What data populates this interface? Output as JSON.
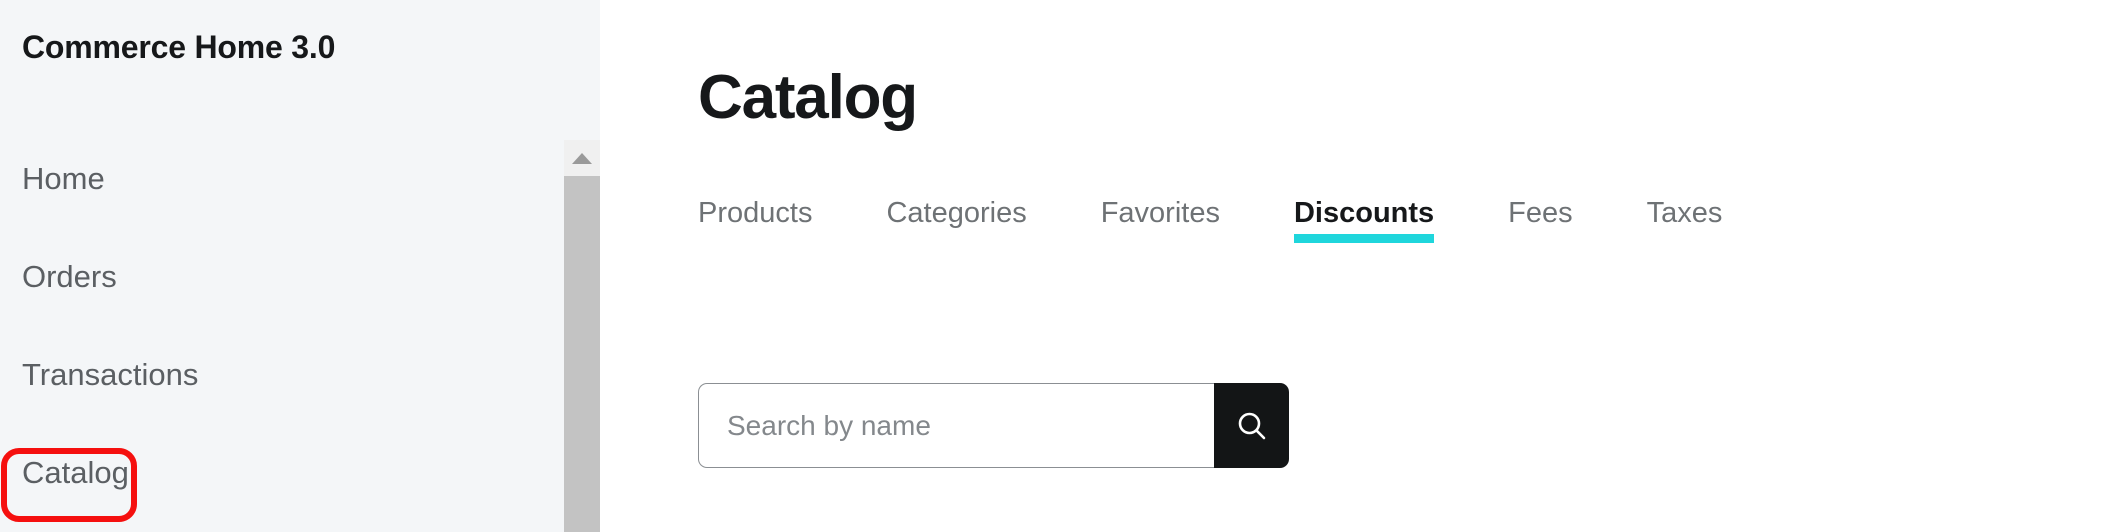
{
  "sidebar": {
    "title": "Commerce Home 3.0",
    "items": [
      {
        "label": "Home",
        "name": "sidebar-item-home"
      },
      {
        "label": "Orders",
        "name": "sidebar-item-orders"
      },
      {
        "label": "Transactions",
        "name": "sidebar-item-transactions"
      },
      {
        "label": "Catalog",
        "name": "sidebar-item-catalog"
      }
    ],
    "scrollbar": {
      "up_arrow_icon": "triangle-up-icon",
      "thumb_color": "#c3c3c3",
      "track_color": "#f0f0f0"
    },
    "annotation": {
      "target_label": "Catalog",
      "color": "#f5100f"
    },
    "background_color": "#f4f6f8"
  },
  "main": {
    "page_title": "Catalog",
    "tabs": [
      {
        "label": "Products",
        "active": false
      },
      {
        "label": "Categories",
        "active": false
      },
      {
        "label": "Favorites",
        "active": false
      },
      {
        "label": "Discounts",
        "active": true
      },
      {
        "label": "Fees",
        "active": false
      },
      {
        "label": "Taxes",
        "active": false
      }
    ],
    "active_tab_underline_color": "#1fd6dc",
    "search": {
      "placeholder": "Search by name",
      "value": "",
      "button_icon": "search-icon",
      "button_color": "#131516"
    }
  }
}
